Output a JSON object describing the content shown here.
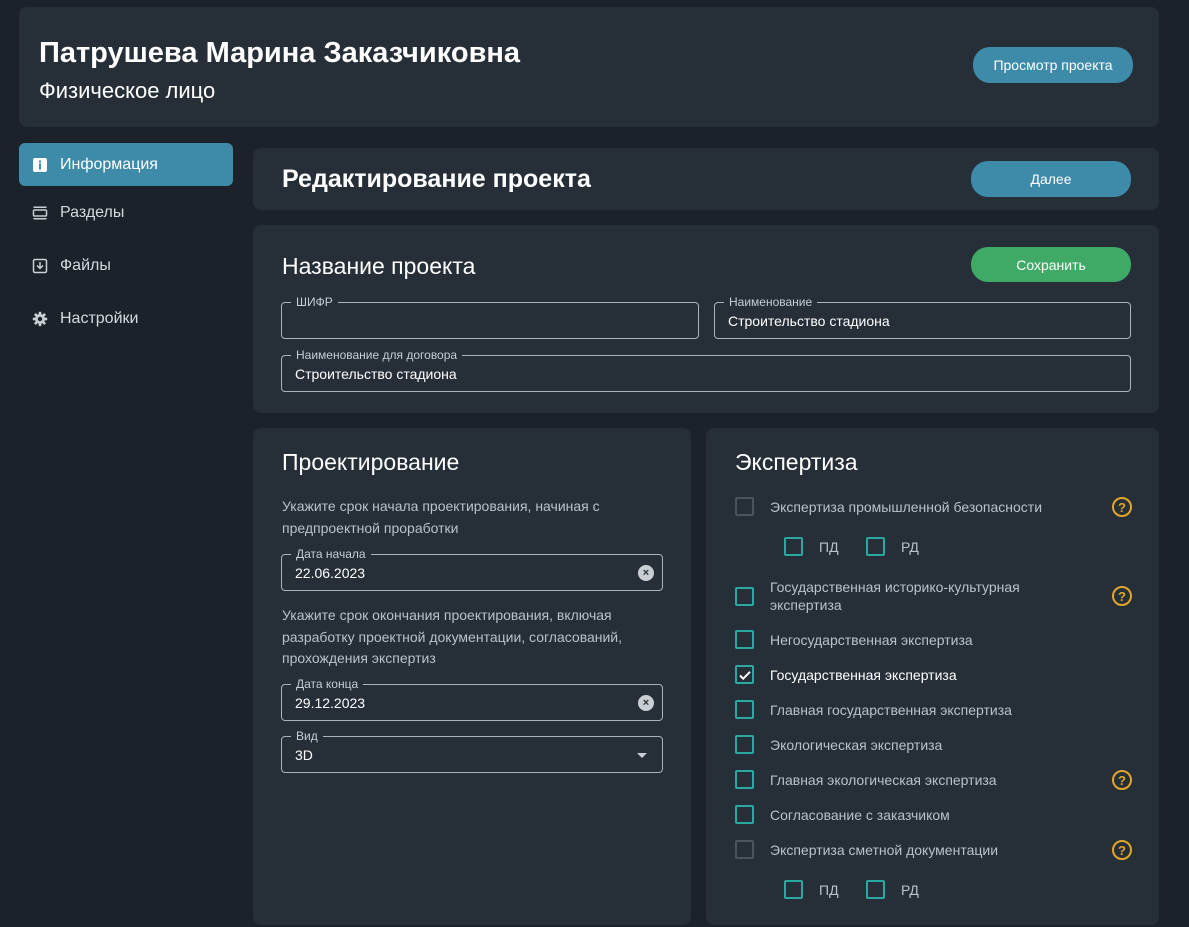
{
  "header": {
    "name": "Патрушева Марина Заказчиковна",
    "type": "Физическое лицо",
    "view_project": "Просмотр проекта"
  },
  "sidebar": {
    "items": [
      {
        "label": "Информация",
        "icon": "info-icon",
        "active": true
      },
      {
        "label": "Разделы",
        "icon": "sections-icon",
        "active": false
      },
      {
        "label": "Файлы",
        "icon": "download-icon",
        "active": false
      },
      {
        "label": "Настройки",
        "icon": "gear-icon",
        "active": false
      }
    ]
  },
  "edit": {
    "title": "Редактирование проекта",
    "next": "Далее"
  },
  "project_name": {
    "title": "Название проекта",
    "save": "Сохранить",
    "cipher_label": "ШИФР",
    "cipher_value": "",
    "name_label": "Наименование",
    "name_value": "Строительство стадиона",
    "contract_label": "Наименование для договора",
    "contract_value": "Строительство стадиона"
  },
  "design": {
    "title": "Проектирование",
    "start_hint": "Укажите срок начала проектирования, начиная с предпроектной проработки",
    "start_label": "Дата начала",
    "start_value": "22.06.2023",
    "end_hint": "Укажите срок окончания проектирования, включая разработку проектной документации, согласований, прохождения экспертиз",
    "end_label": "Дата конца",
    "end_value": "29.12.2023",
    "kind_label": "Вид",
    "kind_value": "3D"
  },
  "expertise": {
    "title": "Экспертиза",
    "colors": {
      "checkbox": "#2aa9a3",
      "help": "#e2a62b"
    },
    "items": [
      {
        "label": "Экспертиза промышленной безопасности",
        "checked": false,
        "disabled": true,
        "help": true
      },
      {
        "label": "Государственная историко-культурная экспертиза",
        "checked": false,
        "disabled": false,
        "help": true
      },
      {
        "label": "Негосударственная экспертиза",
        "checked": false,
        "disabled": false,
        "help": false
      },
      {
        "label": "Государственная экспертиза",
        "checked": true,
        "disabled": false,
        "help": false
      },
      {
        "label": "Главная государственная экспертиза",
        "checked": false,
        "disabled": false,
        "help": false
      },
      {
        "label": "Экологическая экспертиза",
        "checked": false,
        "disabled": false,
        "help": false
      },
      {
        "label": "Главная экологическая экспертиза",
        "checked": false,
        "disabled": false,
        "help": true
      },
      {
        "label": "Согласование с заказчиком",
        "checked": false,
        "disabled": false,
        "help": false
      },
      {
        "label": "Экспертиза сметной документации",
        "checked": false,
        "disabled": true,
        "help": true
      }
    ],
    "sub_pd": "ПД",
    "sub_rd": "РД",
    "help_symbol": "?"
  }
}
